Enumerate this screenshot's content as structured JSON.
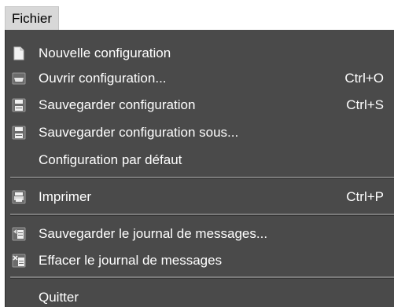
{
  "menubar": {
    "file_label": "Fichier"
  },
  "menu": {
    "items": [
      {
        "label": "Nouvelle configuration",
        "shortcut": "",
        "icon": "new-document-icon"
      },
      {
        "label": "Ouvrir configuration...",
        "shortcut": "Ctrl+O",
        "icon": "open-folder-icon"
      },
      {
        "label": "Sauvegarder configuration",
        "shortcut": "Ctrl+S",
        "icon": "save-icon"
      },
      {
        "label": "Sauvegarder configuration sous...",
        "shortcut": "",
        "icon": "save-as-icon"
      },
      {
        "label": "Configuration par défaut",
        "shortcut": "",
        "icon": ""
      },
      {
        "label": "Imprimer",
        "shortcut": "Ctrl+P",
        "icon": "printer-icon"
      },
      {
        "label": "Sauvegarder le journal de messages...",
        "shortcut": "",
        "icon": "save-log-icon"
      },
      {
        "label": "Effacer le journal de messages",
        "shortcut": "",
        "icon": "clear-log-icon"
      },
      {
        "label": "Quitter",
        "shortcut": "",
        "icon": ""
      }
    ]
  },
  "colors": {
    "menu_background": "#4a4a4a",
    "menu_text": "#ffffff",
    "menubar_background": "#d8d8d8"
  }
}
